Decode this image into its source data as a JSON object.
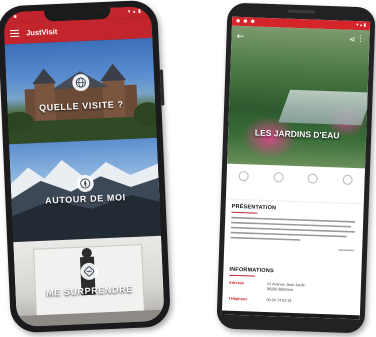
{
  "colors": {
    "brand_red": "#c2262c",
    "phone_body": "#1b1b1d"
  },
  "left_phone": {
    "app_title": "JustVisit",
    "menu_icon": "hamburger-icon",
    "tiles": [
      {
        "label": "QUELLE VISITE ?",
        "icon": "globe-icon"
      },
      {
        "label": "AUTOUR DE MOI",
        "icon": "compass-icon"
      },
      {
        "label": "ME SURPRENDRE",
        "icon": "dice-icon"
      }
    ]
  },
  "right_phone": {
    "hero_title": "LES JARDINS D'EAU",
    "icons": {
      "back": "back-arrow-icon",
      "share": "share-icon",
      "more": "more-icon"
    },
    "sections": {
      "presentation": "PRÉSENTATION",
      "informations": "INFORMATIONS"
    },
    "info": [
      {
        "key": "Adresse",
        "value": "13 Avenue Jean Jardin\n89200 Bâtiment"
      },
      {
        "key": "Téléphone",
        "value": "00 00 74 03 61"
      }
    ]
  }
}
